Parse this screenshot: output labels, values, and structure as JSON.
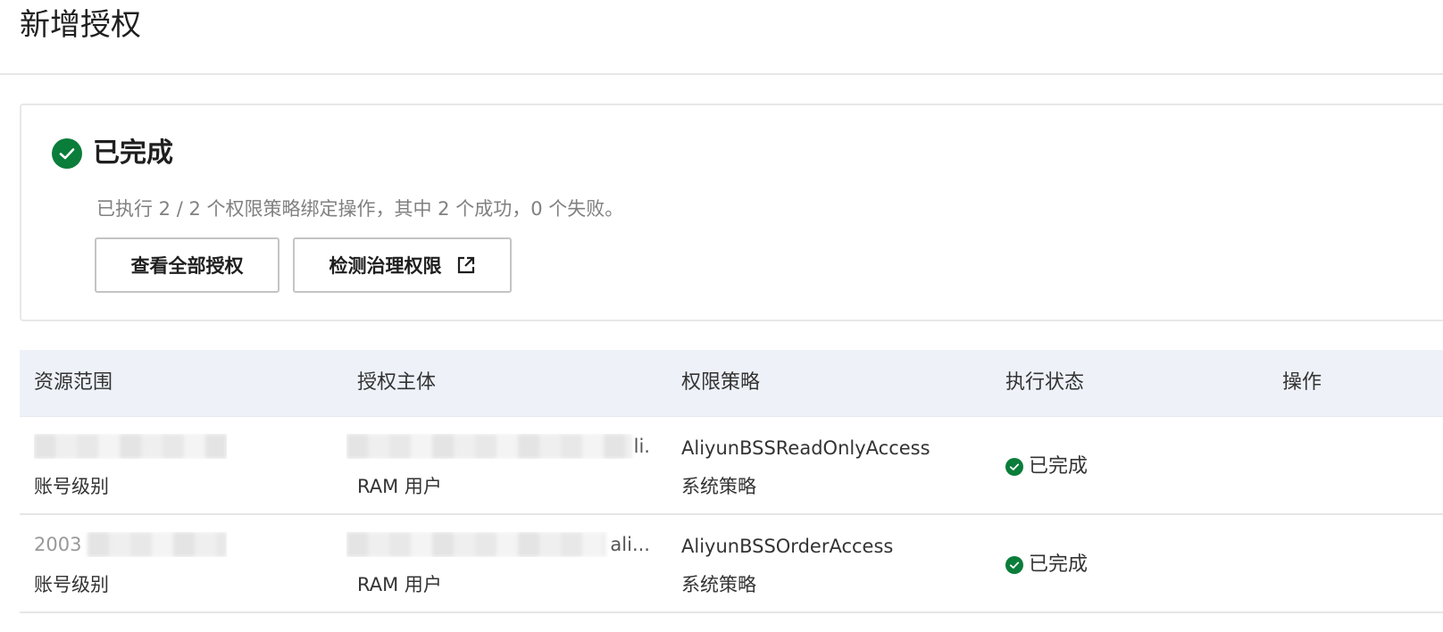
{
  "page": {
    "title": "新增授权"
  },
  "result": {
    "title": "已完成",
    "description": "已执行 2 / 2 个权限策略绑定操作，其中 2 个成功，0 个失败。",
    "buttons": {
      "view_all": "查看全部授权",
      "detect": "检测治理权限"
    }
  },
  "table": {
    "columns": [
      "资源范围",
      "授权主体",
      "权限策略",
      "执行状态",
      "操作"
    ],
    "rows": [
      {
        "resource_scope": "账号级别",
        "principal_tail": "li.",
        "principal_type": "RAM 用户",
        "policy_name": "AliyunBSSReadOnlyAccess",
        "policy_type": "系统策略",
        "status": "已完成"
      },
      {
        "resource_scope_partial": "2003",
        "resource_scope": "账号级别",
        "principal_tail": "ali...",
        "principal_type": "RAM 用户",
        "policy_name": "AliyunBSSOrderAccess",
        "policy_type": "系统策略",
        "status": "已完成"
      }
    ]
  },
  "colors": {
    "success": "#0a7d3a",
    "header_bg": "#eef2f8",
    "border": "#e6e6e6",
    "muted_text": "#808080"
  },
  "icons": {
    "success": "check-circle-icon",
    "external": "external-link-icon"
  }
}
